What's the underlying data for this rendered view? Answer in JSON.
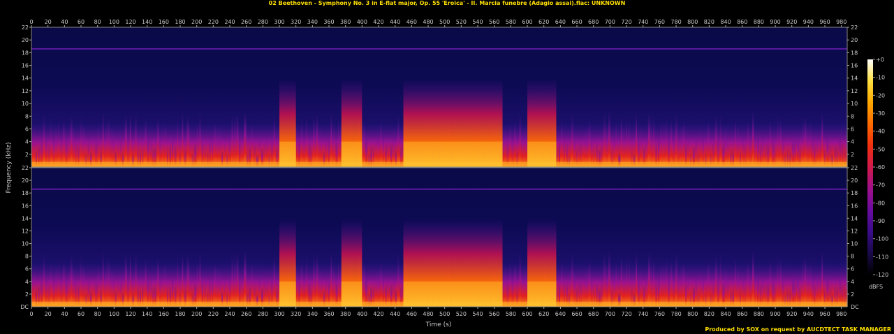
{
  "title": "02 Beethoven - Symphony No. 3 in E-flat major, Op. 55 'Eroica' - II. Marcia funebre (Adagio assai).flac: UNKNOWN",
  "credit": "Produced by SOX on request by AUCDTECT TASK MANAGER",
  "colors": {
    "background": "#000000",
    "title": "#ffe000",
    "axis": "#aaaaaa"
  },
  "chart_data": {
    "type": "heatmap",
    "xlabel": "Time (s)",
    "ylabel": "Frequency (kHz)",
    "xlim": [
      0,
      987
    ],
    "ylim": [
      0,
      22
    ],
    "x_ticks": [
      0,
      20,
      40,
      60,
      80,
      100,
      120,
      140,
      160,
      180,
      200,
      220,
      240,
      260,
      280,
      300,
      320,
      340,
      360,
      380,
      400,
      420,
      440,
      460,
      480,
      500,
      520,
      540,
      560,
      580,
      600,
      620,
      640,
      660,
      680,
      700,
      720,
      740,
      760,
      780,
      800,
      820,
      840,
      860,
      880,
      900,
      920,
      940,
      960,
      980
    ],
    "y_ticks": [
      2,
      4,
      6,
      8,
      10,
      12,
      14,
      16,
      18,
      20,
      22
    ],
    "y_bottom_label": "DC",
    "channels": 2,
    "colorbar": {
      "label": "dBFS",
      "ticks": [
        "+0",
        "-10",
        "-20",
        "-30",
        "-40",
        "-50",
        "-60",
        "-70",
        "-80",
        "-90",
        "-100",
        "-110",
        "-120"
      ],
      "range": [
        -120,
        0
      ],
      "colors": [
        "#000000",
        "#1a0a4a",
        "#3a0c8a",
        "#6a0ca0",
        "#a0108a",
        "#d01a4a",
        "#f03010",
        "#ff6a00",
        "#ffa800",
        "#ffe040",
        "#ffffff"
      ]
    },
    "loud_segments_s": [
      [
        300,
        320
      ],
      [
        375,
        400
      ],
      [
        450,
        570
      ],
      [
        600,
        635
      ]
    ],
    "steady_tone_khz": 18.6
  }
}
